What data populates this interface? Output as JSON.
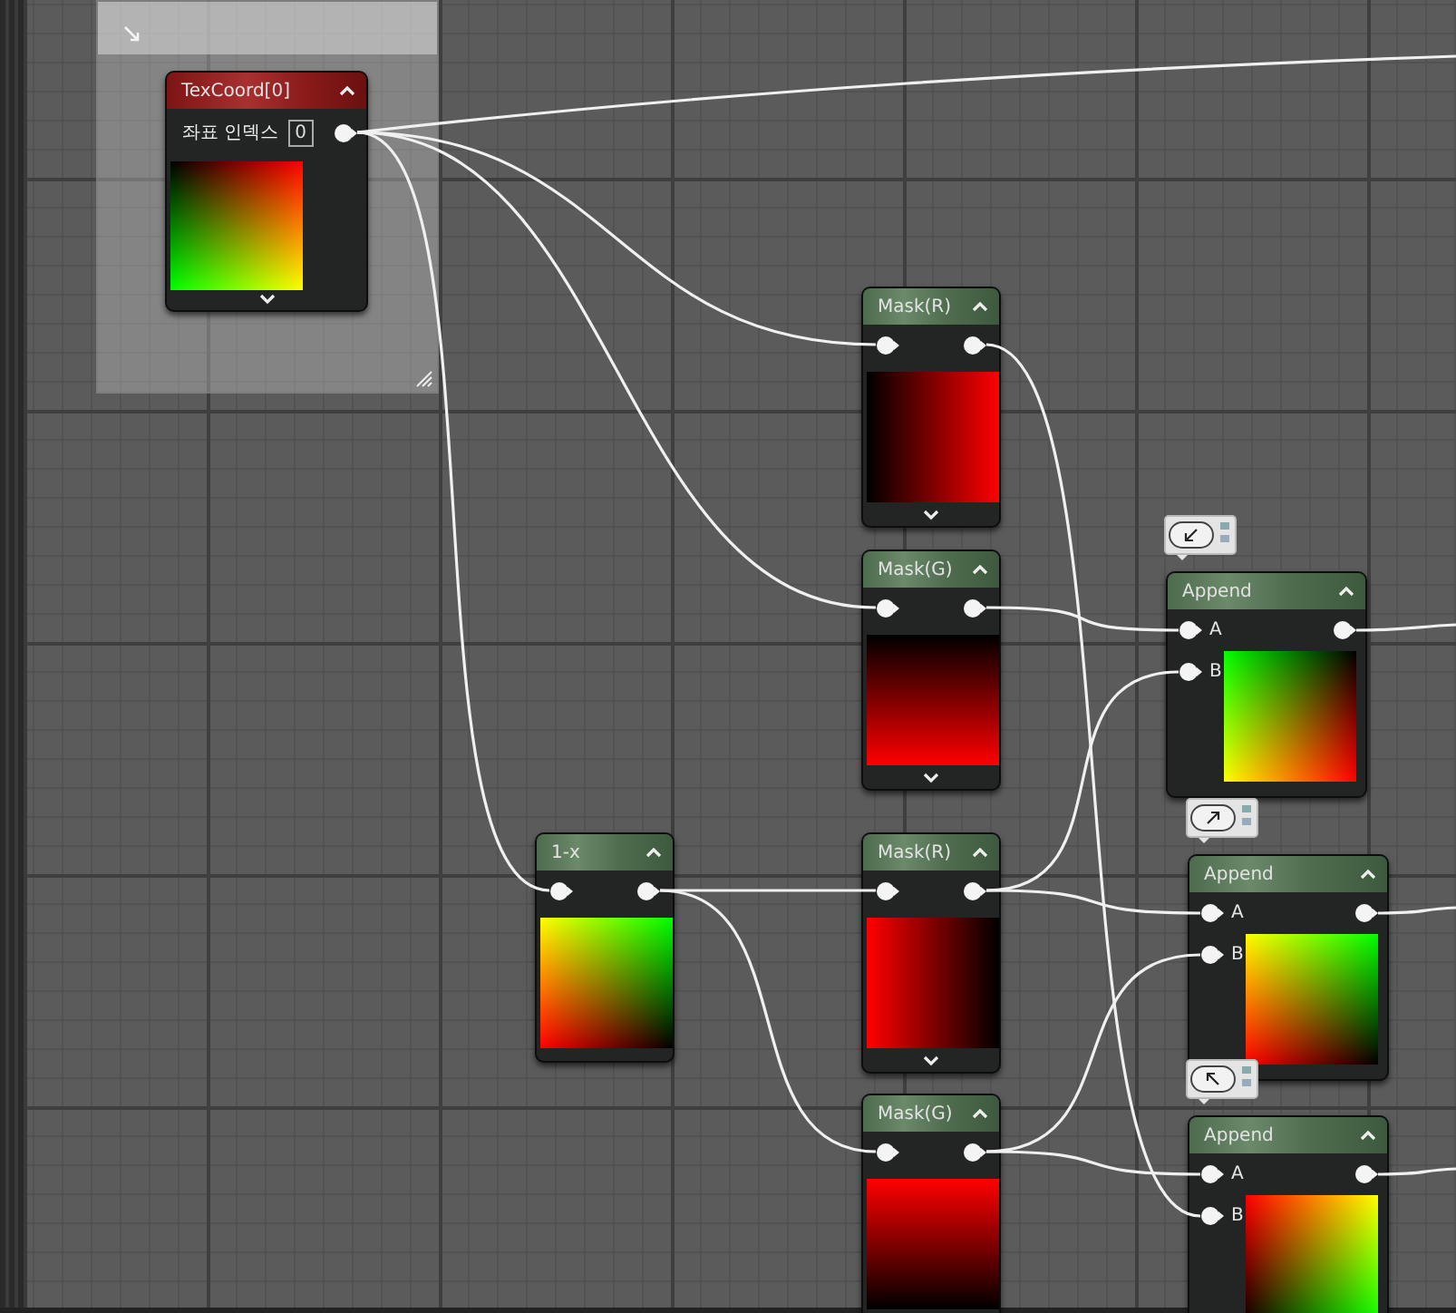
{
  "nodes": [
    {
      "kind": "texcoord",
      "title": "TexCoord[0]",
      "input_label": "좌표 인덱스",
      "input_value": "0",
      "advanced_toggle": true
    },
    {
      "kind": "mask",
      "title": "Mask(R)",
      "advanced_toggle": true
    },
    {
      "kind": "mask",
      "title": "Mask(G)",
      "advanced_toggle": true
    },
    {
      "kind": "mask",
      "title": "1-x",
      "advanced_toggle": false
    },
    {
      "kind": "mask",
      "title": "Mask(R)",
      "advanced_toggle": true
    },
    {
      "kind": "mask",
      "title": "Mask(G)",
      "advanced_toggle": false
    },
    {
      "kind": "append",
      "title": "Append",
      "pins": [
        "A",
        "B"
      ],
      "advanced_toggle": false
    },
    {
      "kind": "append",
      "title": "Append",
      "pins": [
        "A",
        "B"
      ],
      "advanced_toggle": false
    },
    {
      "kind": "append",
      "title": "Append",
      "pins": [
        "A",
        "B"
      ],
      "advanced_toggle": false
    }
  ]
}
